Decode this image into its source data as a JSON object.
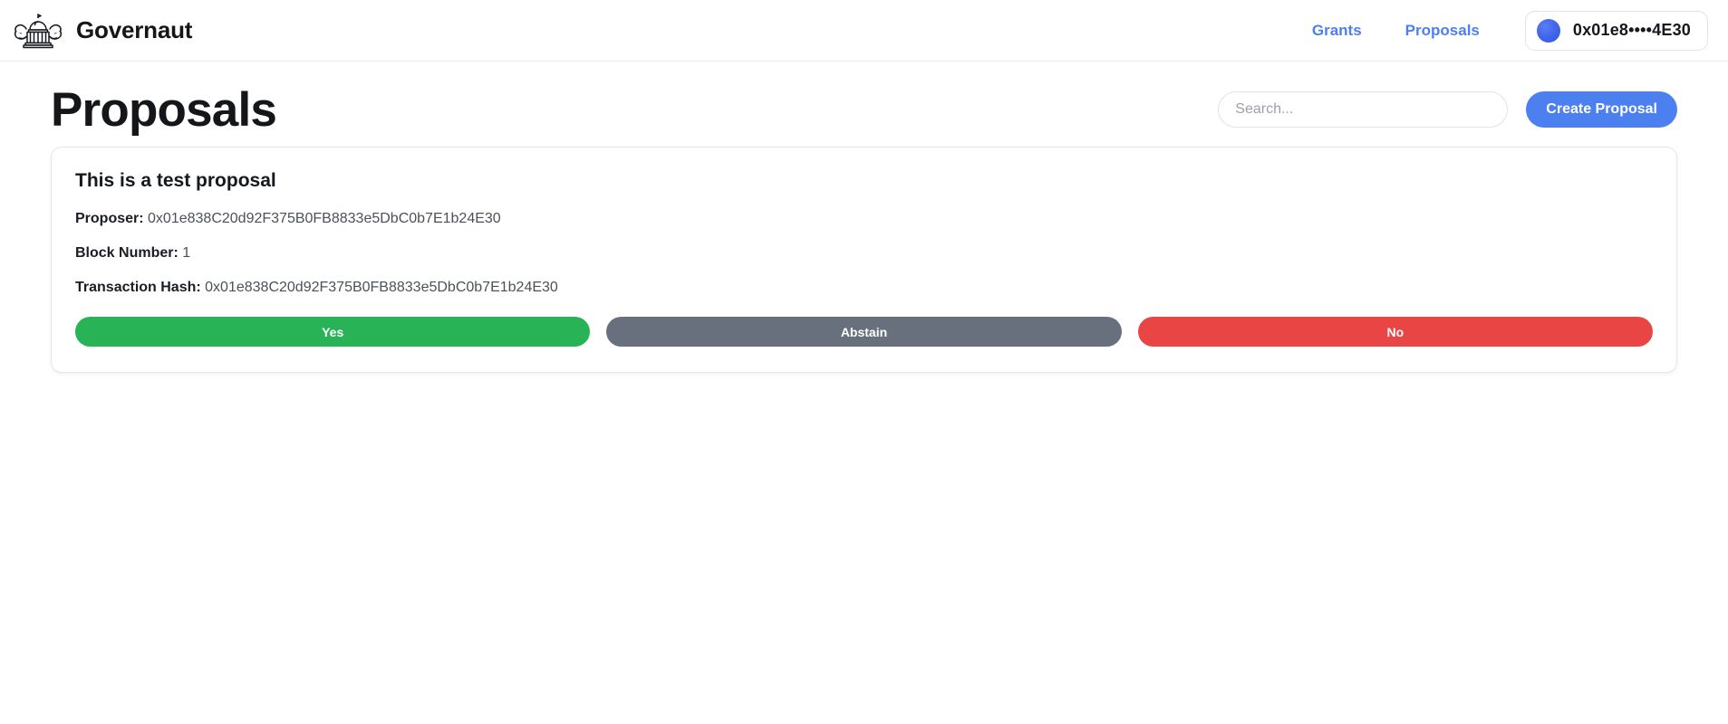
{
  "navbar": {
    "brand": {
      "name": "Governaut",
      "logo_icon": "capitol-flex-logo-icon"
    },
    "links": [
      {
        "label": "Grants"
      },
      {
        "label": "Proposals"
      }
    ],
    "wallet": {
      "avatar_icon": "wallet-avatar-icon",
      "address": "0x01e8••••4E30"
    }
  },
  "page": {
    "title": "Proposals",
    "search": {
      "placeholder": "Search...",
      "value": ""
    },
    "create_button": {
      "label": "Create Proposal"
    }
  },
  "proposals": [
    {
      "title": "This is a test proposal",
      "proposer_label": "Proposer:",
      "proposer_value": "0x01e838C20d92F375B0FB8833e5DbC0b7E1b24E30",
      "block_label": "Block Number:",
      "block_value": "1",
      "tx_label": "Transaction Hash:",
      "tx_value": "0x01e838C20d92F375B0FB8833e5DbC0b7E1b24E30",
      "votes": {
        "yes": "Yes",
        "abstain": "Abstain",
        "no": "No"
      }
    }
  ],
  "colors": {
    "accent_blue": "#4c7ff0",
    "vote_yes_green": "#28b357",
    "vote_abstain_gray": "#69707d",
    "vote_no_red": "#ea4545",
    "text_dark": "#15181d",
    "border_light": "#e4e7ea"
  }
}
